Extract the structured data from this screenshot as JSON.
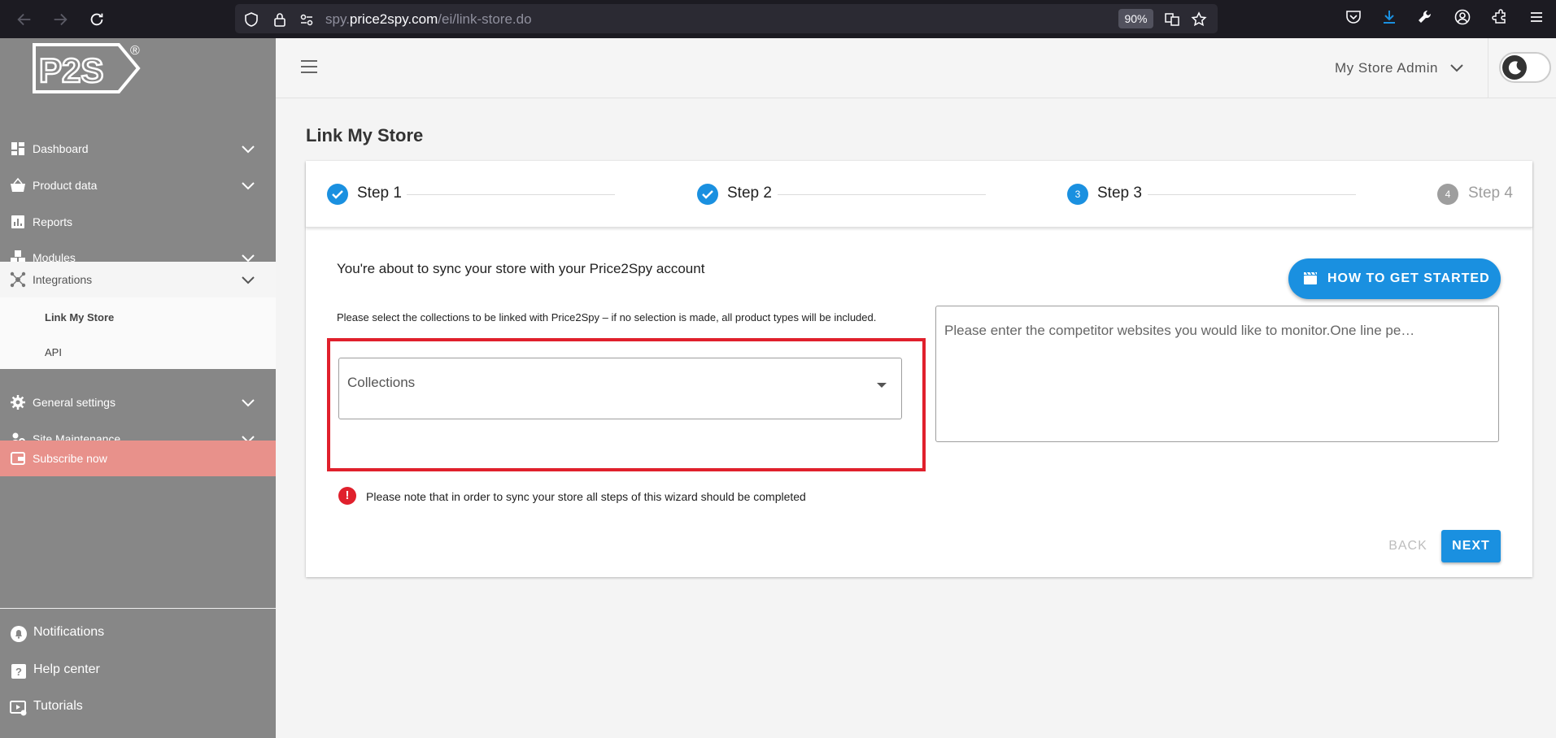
{
  "browser": {
    "url_prefix": "spy.",
    "url_domain": "price2spy.com",
    "url_path": "/ei/link-store.do",
    "zoom": "90%"
  },
  "sidebar": {
    "logo_text": "P2S",
    "logo_mark": "®",
    "items": [
      {
        "label": "Dashboard"
      },
      {
        "label": "Product data"
      },
      {
        "label": "Reports"
      },
      {
        "label": "Modules"
      },
      {
        "label": "Integrations"
      },
      {
        "label": "General settings"
      },
      {
        "label": "Site Maintenance"
      },
      {
        "label": "Subscribe now"
      }
    ],
    "sub_items": [
      {
        "label": "Link My Store"
      },
      {
        "label": "API"
      }
    ],
    "bottom": [
      {
        "label": "Notifications"
      },
      {
        "label": "Help center"
      },
      {
        "label": "Tutorials"
      }
    ]
  },
  "header": {
    "user_label": "My Store Admin"
  },
  "page": {
    "title": "Link My Store"
  },
  "stepper": {
    "steps": [
      {
        "label": "Step 1",
        "state": "done"
      },
      {
        "label": "Step 2",
        "state": "done"
      },
      {
        "label": "Step 3",
        "number": "3",
        "state": "active"
      },
      {
        "label": "Step 4",
        "number": "4",
        "state": "inactive"
      }
    ]
  },
  "content": {
    "sync_title": "You're about to sync your store with your Price2Spy account",
    "howto_label": "HOW TO GET STARTED",
    "instruction": "Please select the collections to be linked with Price2Spy – if no selection is made, all product types will be included.",
    "collections_label": "Collections",
    "competitor_placeholder": "Please enter the competitor websites you would like to monitor.One line pe…",
    "warning": "Please note that in order to sync your store all steps of this wizard should be completed",
    "back_label": "BACK",
    "next_label": "NEXT"
  },
  "colors": {
    "accent": "#1a90e0",
    "sidebar": "#878787",
    "subscribe": "#e8918b",
    "highlight": "#e0202c"
  }
}
